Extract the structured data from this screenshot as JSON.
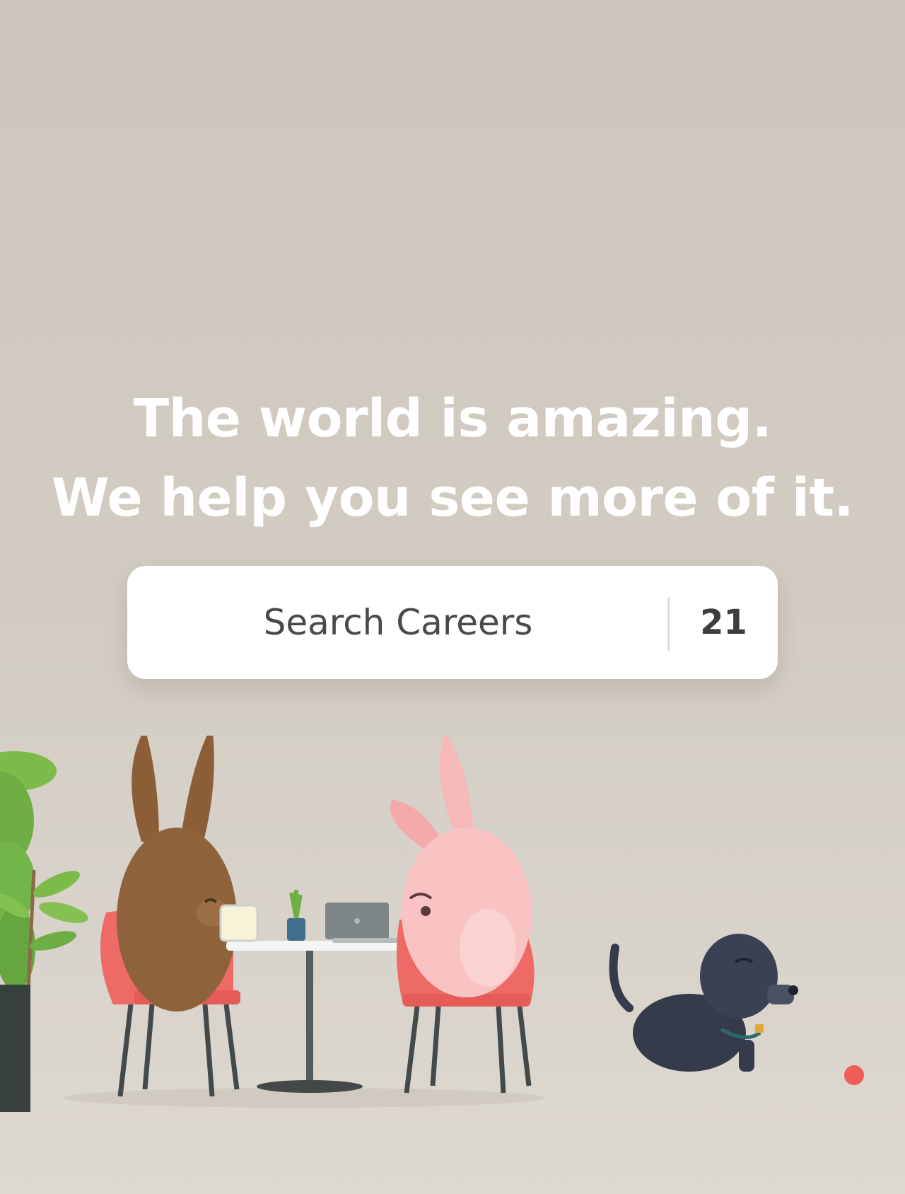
{
  "headline": {
    "line1": "The world is amazing.",
    "line2": "We help you see more of it."
  },
  "search": {
    "label": "Search Careers",
    "count": "21"
  },
  "colors": {
    "background": "#cdc6bc",
    "headline_text": "#ffffff",
    "search_background": "#ffffff",
    "search_text": "#4a4848",
    "chair": "#ee6a66",
    "plant": "#7cba4a",
    "dog": "#363b4c",
    "brown_rabbit": "#8b5e38",
    "pink_rabbit": "#f6b8b8"
  },
  "illustration": {
    "characters": [
      "brown-rabbit",
      "pink-rabbit",
      "black-dog"
    ],
    "objects": [
      "potted-plant",
      "cafe-table",
      "laptop",
      "small-plant",
      "red-chair",
      "red-chair",
      "red-ball"
    ]
  }
}
